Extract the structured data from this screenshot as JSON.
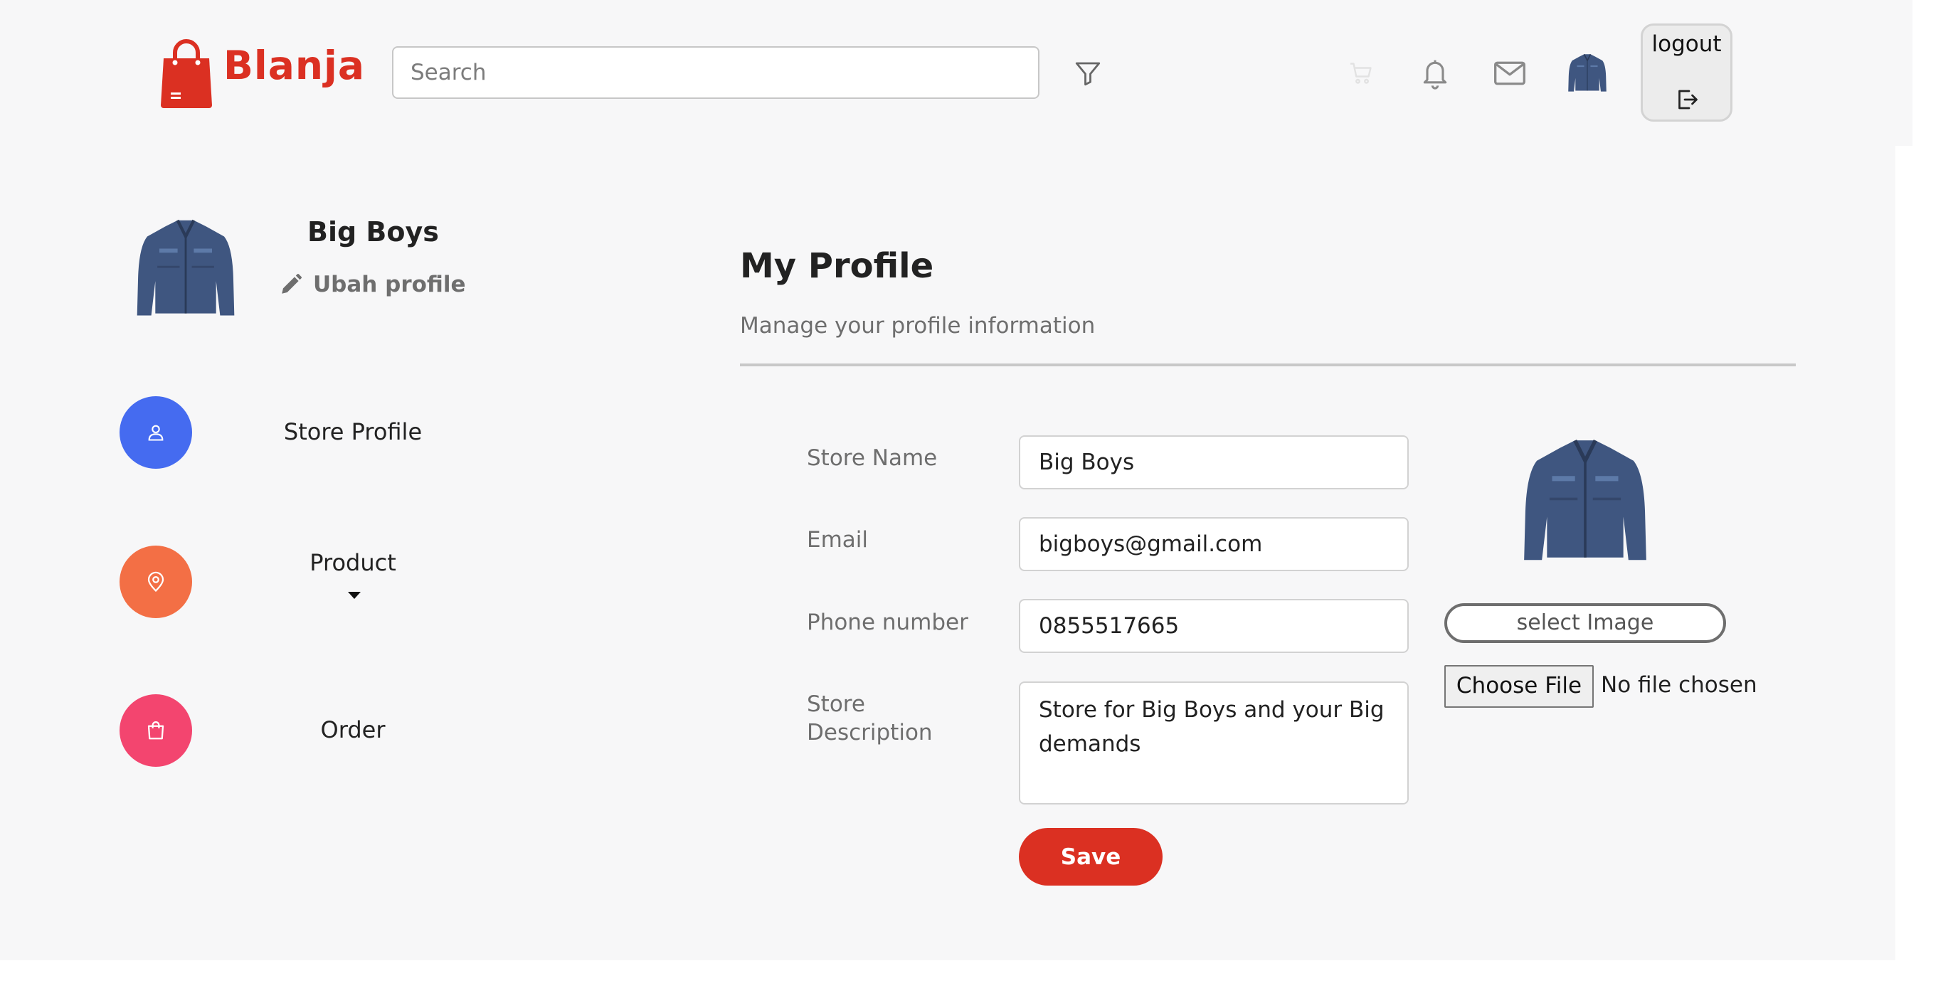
{
  "brand": {
    "name": "Blanja",
    "color": "#db3022"
  },
  "header": {
    "search_placeholder": "Search",
    "icons": [
      "filter-icon",
      "cart-icon",
      "bell-icon",
      "mail-icon",
      "avatar"
    ],
    "logout_label": "logout"
  },
  "sidebar": {
    "store_name": "Big Boys",
    "edit_label": "Ubah profile",
    "items": [
      {
        "label": "Store Profile",
        "icon": "user-icon",
        "color": "#456bf0"
      },
      {
        "label": "Product",
        "icon": "location-pin-icon",
        "color": "#f36f45"
      },
      {
        "label": "Order",
        "icon": "shopping-bag-icon",
        "color": "#f3456f"
      }
    ]
  },
  "main": {
    "title": "My Profile",
    "subtitle": "Manage your profile information",
    "fields": {
      "store_name": {
        "label": "Store Name",
        "value": "Big Boys"
      },
      "email": {
        "label": "Email",
        "value": "bigboys@gmail.com"
      },
      "phone": {
        "label": "Phone number",
        "value": "0855517665"
      },
      "description": {
        "label": "Store Description",
        "value": "Store for Big Boys and your Big demands"
      }
    },
    "save_label": "Save",
    "select_image_label": "select Image",
    "choose_file_label": "Choose File",
    "no_file_label": "No file chosen"
  }
}
